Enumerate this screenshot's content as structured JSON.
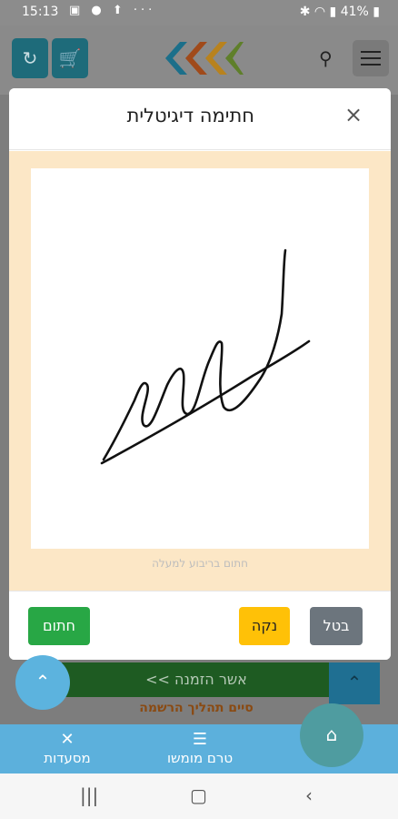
{
  "status_bar": {
    "time": "15:13",
    "battery": "41%"
  },
  "modal": {
    "title": "חתימה דיגיטלית",
    "close_label": "×",
    "signature_hint": "חתום בריבוע למעלה",
    "buttons": {
      "sign": "חתום",
      "clear": "נקה",
      "cancel": "בטל"
    }
  },
  "page": {
    "confirm_order": "אשר הזמנה >>",
    "finish_registration": "סיים תהליך הרשמה"
  },
  "bottom_nav": {
    "items": [
      {
        "label": "מסעדות"
      },
      {
        "label": "טרם מומשו"
      }
    ]
  }
}
